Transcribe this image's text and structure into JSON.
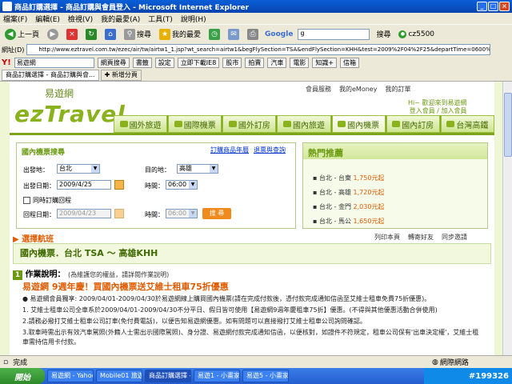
{
  "window": {
    "title": "商品訂購選擇 - 商品訂購與會員登入 - Microsoft Internet Explorer"
  },
  "menu": [
    "檔案(F)",
    "編輯(E)",
    "檢視(V)",
    "我的最愛(A)",
    "工具(T)",
    "說明(H)"
  ],
  "nav": {
    "back": "上一頁",
    "search": "搜尋",
    "favorites": "我的最愛",
    "google": "Google",
    "google_input": "g",
    "search_btn": "搜尋",
    "user": "cz5500"
  },
  "address": {
    "label": "網址(D)",
    "url": "http://www.eztravel.com.tw/ezec/air/tw/airtw1_1.jsp?wt_search=airtw1&begFlySection=TSA&endFlySection=KHH&test=2009%2F04%2F25&departTime=0600%2C0612%2C0934&flyDa"
  },
  "yahoo": {
    "logo": "Y!",
    "search": "易遊網",
    "btn_web": "網頁搜尋",
    "btn_bookmark": "書籤",
    "btn_settings": "設定",
    "btn_download": "立即下載IE8",
    "btn_stock": "股市",
    "btn_auction": "拍賣",
    "btn_car": "汽車",
    "btn_power": "電影",
    "btn_know": "知識+",
    "btn_mail": "信箱"
  },
  "tabs": [
    {
      "label": "商品訂購選擇 - 商品訂購與會..."
    },
    {
      "label": "新增分頁"
    }
  ],
  "site": {
    "logo_sub": "易遊網",
    "logo_main": "ezTravel",
    "member_links": [
      "會員服務",
      "我的eMoney",
      "我的訂單"
    ],
    "greet1": "Hi~ 歡迎來到易遊網",
    "greet2": "登入會員 / 加入會員",
    "nav_tabs": [
      "國外旅遊",
      "國際機票",
      "國外訂房",
      "國內旅遊",
      "國內機票",
      "國內訂房",
      "台灣高鐵"
    ]
  },
  "search": {
    "title": "國內機票搜尋",
    "links": [
      "訂購商品年曆",
      "退票與查詢"
    ],
    "depart_label": "出發地：",
    "depart_value": "台北",
    "dest_label": "目的地：",
    "dest_value": "高雄",
    "date_label": "出發日期：",
    "date_value": "2009/4/25",
    "time_label": "時間：",
    "time_value": "06:00",
    "roundtrip_label": "同時訂購回程",
    "return_label": "回程日期：",
    "return_value": "2009/04/23",
    "return_time_label": "時間：",
    "return_time_value": "06:00",
    "submit": "搜 尋"
  },
  "hot": {
    "title": "熱門推薦",
    "items": [
      {
        "route": "台北 - 台東",
        "price": "1,750元起"
      },
      {
        "route": "台北 - 高雄",
        "price": "1,720元起"
      },
      {
        "route": "台北 - 金門",
        "price": "2,030元起"
      },
      {
        "route": "台北 - 馬公",
        "price": "1,650元起"
      }
    ]
  },
  "results": {
    "title": "選擇航班",
    "tools": [
      "列印本頁",
      "轉寄好友",
      "同步邀請"
    ],
    "route": "國內機票．台北 TSA ～ 高雄KHH",
    "instr_num": "1",
    "instr_title": "作業說明：",
    "instr_note": "(為維護您的權益，請詳閱作業說明)",
    "promo": "易遊網 9週年慶！買國內機票送艾維士租車75折優惠",
    "paras": [
      "● 易遊網會員獨享: 2009/04/01-2009/04/30於易遊網線上購買國內機票(請在完成付款後，憑付款完成通知信函至艾維士租車免費75折優惠)。",
      "1. 艾維士租車公司全車系於2009/04/01-2009/04/30不分平日、假日皆可使用【易遊網9週年慶租車75折】優惠。(不得與其他優惠活動合併使用)",
      "2.請務必撥打艾維士租車公司訂車(免付費電話)，以便告知易遊網優惠。如有問題可以直接撥打艾維士租車公司詢問確認。",
      "3.取車時需出示有效汽車駕照(外籍人士需出示國際駕照)、身分證、易遊網付款完成通知信函，以便核對，如證件不符規定，租車公司保有'出車決定權'，艾維士租",
      "車需持信用卡付款。"
    ]
  },
  "status": {
    "text": "完成",
    "zone": "網際網路"
  },
  "taskbar": {
    "start": "開始",
    "items": [
      "易遊網 - Yahoo!...",
      "Mobile01 旅遊與...",
      "商品訂購選擇 - ...",
      "易遊1 - 小畫家",
      "易遊5 - 小畫家"
    ],
    "tray": "#199326"
  }
}
